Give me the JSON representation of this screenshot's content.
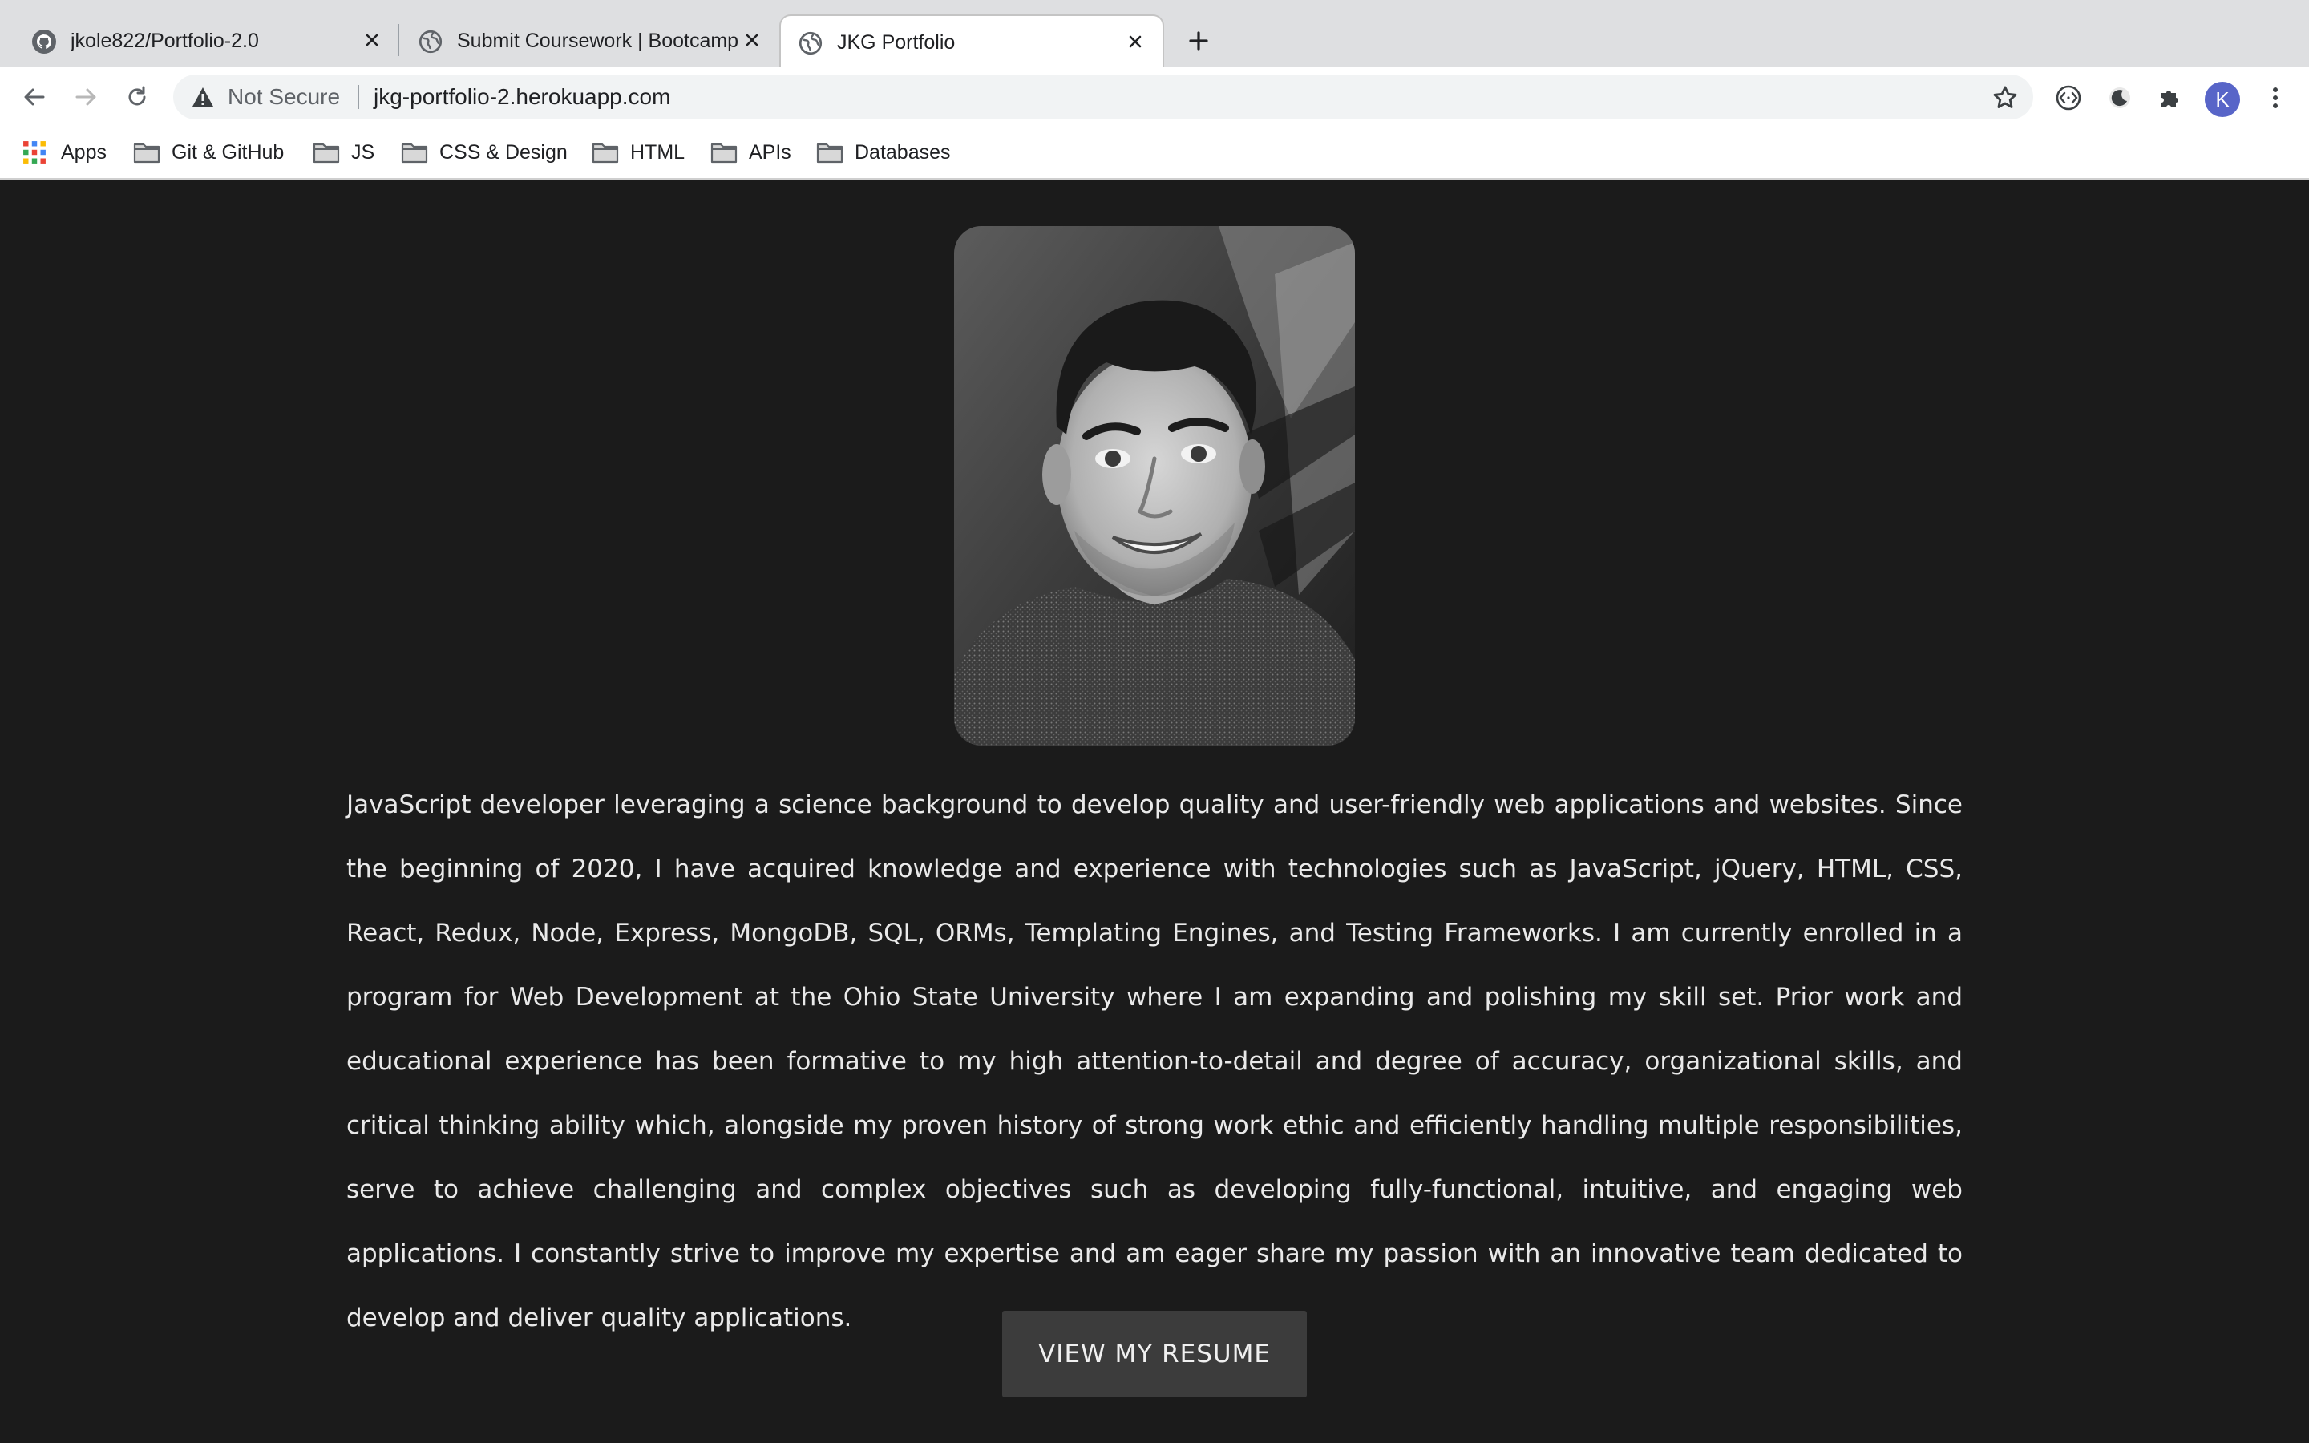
{
  "browser": {
    "tabs": [
      {
        "title": "jkole822/Portfolio-2.0",
        "favicon": "github-icon",
        "active": false
      },
      {
        "title": "Submit Coursework | Bootcamp",
        "favicon": "globe-icon",
        "active": false
      },
      {
        "title": "JKG Portfolio",
        "favicon": "globe-icon",
        "active": true
      }
    ],
    "address_bar": {
      "security_label": "Not Secure",
      "url": "jkg-portfolio-2.herokuapp.com"
    },
    "profile_initial": "K",
    "extensions": [
      "code-brackets-icon",
      "dark-mode-icon",
      "puzzle-icon"
    ],
    "bookmarks": [
      {
        "label": "Apps",
        "icon": "apps-grid-icon"
      },
      {
        "label": "Git & GitHub",
        "icon": "folder-icon"
      },
      {
        "label": "JS",
        "icon": "folder-icon"
      },
      {
        "label": "CSS & Design",
        "icon": "folder-icon"
      },
      {
        "label": "HTML",
        "icon": "folder-icon"
      },
      {
        "label": "APIs",
        "icon": "folder-icon"
      },
      {
        "label": "Databases",
        "icon": "folder-icon"
      }
    ]
  },
  "page": {
    "background": "#1b1b1b",
    "bio": "JavaScript developer leveraging a science background to develop quality and user-friendly web applications and websites. Since the beginning of 2020, I have acquired knowledge and experience with technologies such as JavaScript, jQuery, HTML, CSS, React, Redux, Node, Express, MongoDB, SQL, ORMs, Templating Engines, and Testing Frameworks. I am currently enrolled in a program for Web Development at the Ohio State University where I am expanding and polishing my skill set. Prior work and educational experience has been formative to my high attention-to-detail and degree of accuracy, organizational skills, and critical thinking ability which, alongside my proven history of strong work ethic and efficiently handling multiple responsibilities, serve to achieve challenging and complex objectives such as developing fully-functional, intuitive, and engaging web applications. I constantly strive to improve my expertise and am eager share my passion with an innovative team dedicated to develop and deliver quality applications.",
    "resume_button": "VIEW MY RESUME"
  }
}
